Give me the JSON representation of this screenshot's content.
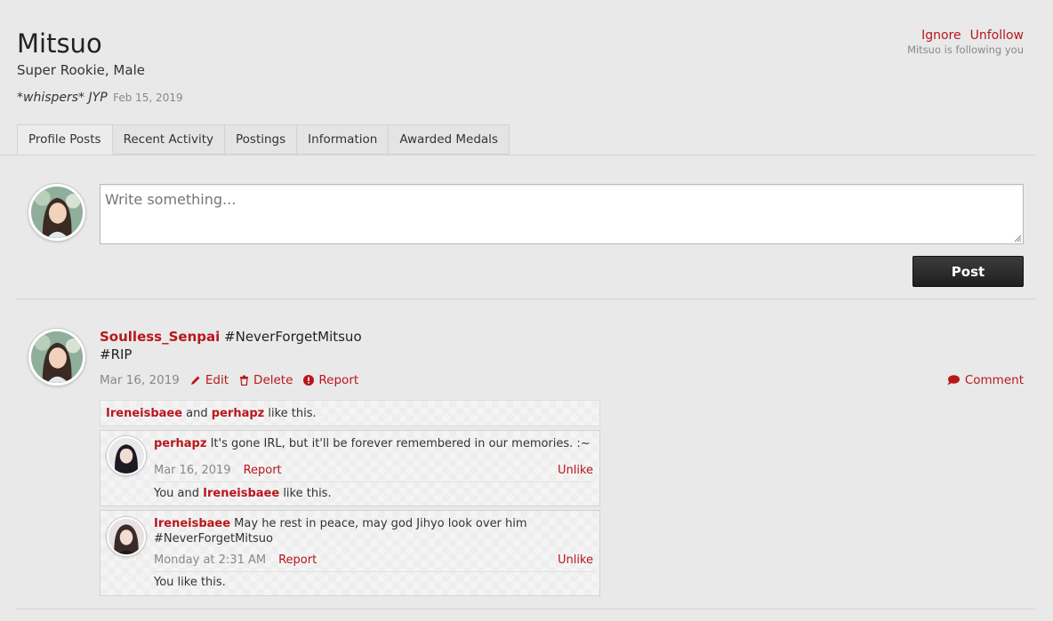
{
  "profile": {
    "name": "Mitsuo",
    "subtitle": "Super Rookie, Male",
    "status": "*whispers* JYP",
    "status_date": "Feb 15, 2019"
  },
  "header_actions": {
    "ignore": "Ignore",
    "unfollow": "Unfollow",
    "follow_note": "Mitsuo is following you"
  },
  "tabs": [
    {
      "label": "Profile Posts"
    },
    {
      "label": "Recent Activity"
    },
    {
      "label": "Postings"
    },
    {
      "label": "Information"
    },
    {
      "label": "Awarded Medals"
    }
  ],
  "composer": {
    "placeholder": "Write something...",
    "post_label": "Post"
  },
  "message": {
    "author": "Soulless_Senpai",
    "text_line1": " #NeverForgetMitsuo",
    "text_line2": "#RIP",
    "date": "Mar 16, 2019",
    "edit": "Edit",
    "delete": "Delete",
    "report": "Report",
    "comment": "Comment",
    "likes": {
      "user1": "Ireneisbaee",
      "and": " and ",
      "user2": "perhapz",
      "suffix": " like this."
    }
  },
  "comments": [
    {
      "author": "perhapz",
      "text": " It's gone IRL, but it'll be forever remembered in our memories. :~",
      "time": "Mar 16, 2019",
      "report": "Report",
      "unlike": "Unlike",
      "likes_prefix": "You and ",
      "likes_user": "Ireneisbaee",
      "likes_suffix": " like this."
    },
    {
      "author": "Ireneisbaee",
      "text": " May he rest in peace, may god Jihyo look over him #NeverForgetMitsuo",
      "time": "Monday at 2:31 AM",
      "report": "Report",
      "unlike": "Unlike",
      "likes": "You like this."
    }
  ],
  "colors": {
    "accent": "#b8171c",
    "background": "#e9e9e9",
    "button": "#2a2a2a"
  }
}
